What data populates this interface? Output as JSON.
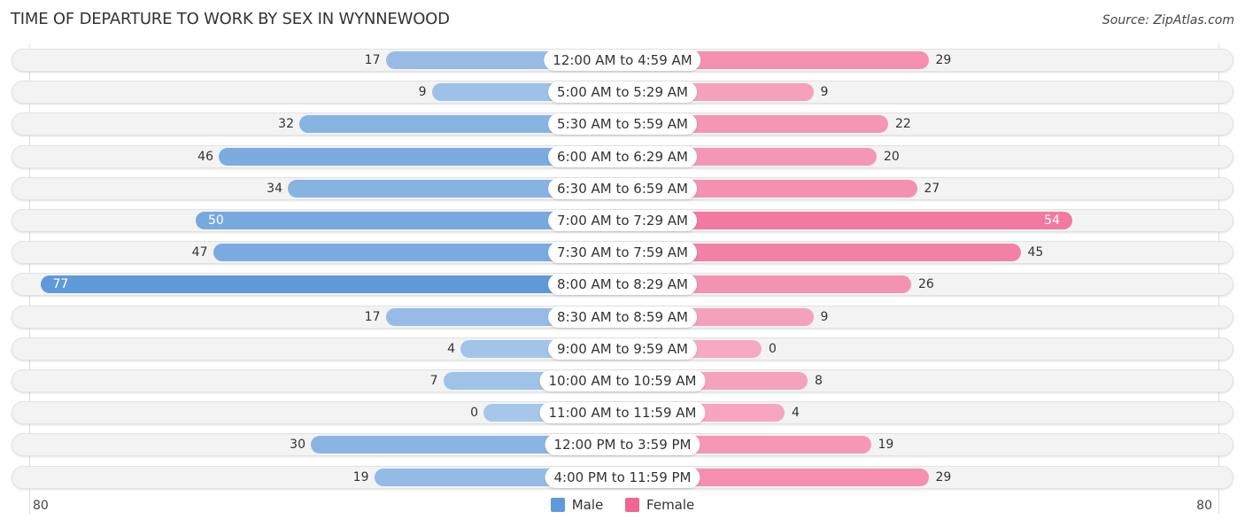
{
  "title": "TIME OF DEPARTURE TO WORK BY SEX IN WYNNEWOOD",
  "source": "Source: ZipAtlas.com",
  "colors": {
    "male_light": "#a6c6ea",
    "male_dark": "#5e9ad9",
    "female_light": "#f6a9c2",
    "female_dark": "#f06592"
  },
  "chart_data": {
    "type": "bar",
    "orientation": "horizontal-diverging",
    "title": "TIME OF DEPARTURE TO WORK BY SEX IN WYNNEWOOD",
    "categories": [
      "12:00 AM to 4:59 AM",
      "5:00 AM to 5:29 AM",
      "5:30 AM to 5:59 AM",
      "6:00 AM to 6:29 AM",
      "6:30 AM to 6:59 AM",
      "7:00 AM to 7:29 AM",
      "7:30 AM to 7:59 AM",
      "8:00 AM to 8:29 AM",
      "8:30 AM to 8:59 AM",
      "9:00 AM to 9:59 AM",
      "10:00 AM to 10:59 AM",
      "11:00 AM to 11:59 AM",
      "12:00 PM to 3:59 PM",
      "4:00 PM to 11:59 PM"
    ],
    "series": [
      {
        "name": "Male",
        "values": [
          17,
          9,
          32,
          46,
          34,
          50,
          47,
          77,
          17,
          4,
          7,
          0,
          30,
          19
        ]
      },
      {
        "name": "Female",
        "values": [
          29,
          9,
          22,
          20,
          27,
          54,
          45,
          26,
          9,
          0,
          8,
          4,
          19,
          29
        ]
      }
    ],
    "xlim": [
      -80,
      80
    ],
    "axis_tick_labels": {
      "left": "80",
      "right": "80"
    },
    "legend": {
      "position": "bottom-center",
      "entries": [
        "Male",
        "Female"
      ]
    },
    "grid": false
  }
}
